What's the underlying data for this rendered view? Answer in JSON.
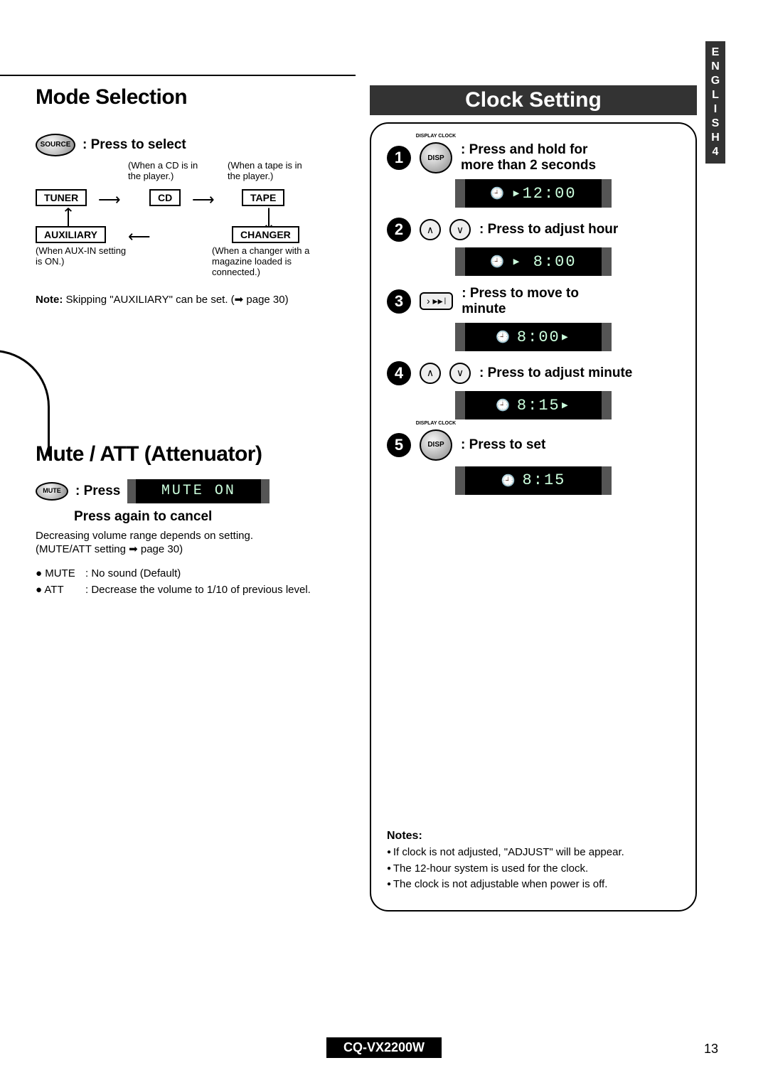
{
  "sideTab": "E\nN\nG\nL\nI\nS\nH\n4",
  "modeSelection": {
    "title": "Mode Selection",
    "sourceBtn": "SOURCE",
    "sourceInstr": ": Press to select",
    "cdNote": "(When a CD is in the player.)",
    "tapeNote": "(When a tape is in the player.)",
    "tuner": "TUNER",
    "cd": "CD",
    "tape": "TAPE",
    "auxiliary": "AUXILIARY",
    "changer": "CHANGER",
    "auxNote": "(When AUX-IN setting is ON.)",
    "changerNote": "(When a changer with a magazine loaded is connected.)",
    "note": "Note:",
    "noteText": " Skipping \"AUXILIARY\" can be set. (➡ page 30)"
  },
  "mute": {
    "title": "Mute / ATT (Attenuator)",
    "btn": "MUTE",
    "press": ": Press",
    "lcd": "MUTE ON",
    "pressAgain": "Press again to cancel",
    "desc1": "Decreasing volume range depends on setting.",
    "desc2": "(MUTE/ATT setting ➡ page 30)",
    "muteLbl": "● MUTE",
    "muteDef": ": No sound (Default)",
    "attLbl": "● ATT",
    "attDef": ": Decrease the volume to 1/10 of previous level."
  },
  "clock": {
    "title": "Clock Setting",
    "dispLabel": "DISPLAY CLOCK",
    "dispBtn": "DISP",
    "step1": ": Press and hold for more than 2 seconds",
    "lcd1": "▸12:00",
    "step2": ": Press to adjust hour",
    "lcd2": "▸ 8:00",
    "step3": ": Press to move to minute",
    "lcd3": "  8:00▸",
    "step4": ": Press to adjust minute",
    "lcd4": "  8:15▸",
    "step5": ": Press to set",
    "lcd5": "  8:15",
    "notesTitle": "Notes:",
    "notes": [
      "If clock is not adjusted, \"ADJUST\" will be appear.",
      "The 12-hour system is used for the clock.",
      "The clock is not adjustable when power is off."
    ]
  },
  "footer": {
    "model": "CQ-VX2200W",
    "page": "13"
  }
}
